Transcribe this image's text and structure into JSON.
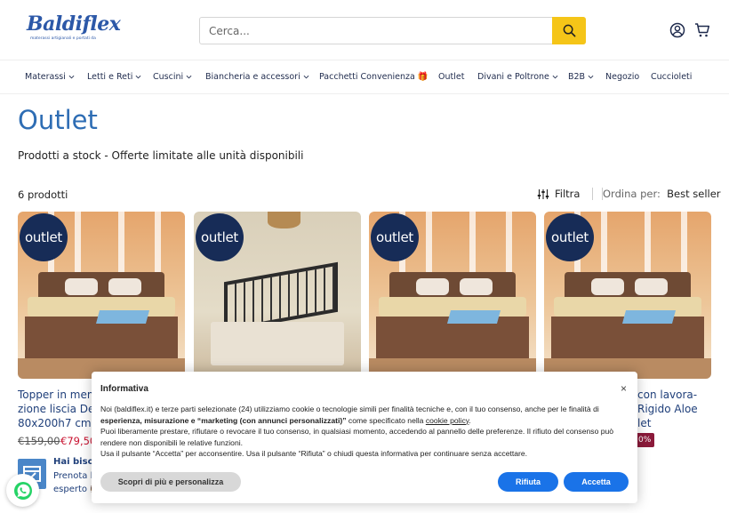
{
  "header": {
    "logo_text": "Baldiflex",
    "logo_tagline": "materassi artigianali e portati da",
    "search_placeholder": "Cerca...",
    "icons": [
      "search-icon",
      "account-icon",
      "cart-icon"
    ],
    "accent_color": "#f5c518"
  },
  "nav": {
    "items": [
      {
        "label": "Materassi",
        "dropdown": true
      },
      {
        "label": "Letti e Reti",
        "dropdown": true
      },
      {
        "label": "Cuscini",
        "dropdown": true
      },
      {
        "label": "Biancheria e accessori",
        "dropdown": true
      },
      {
        "label": "Pacchetti Convenienza 🎁",
        "dropdown": false
      },
      {
        "label": "Outlet",
        "dropdown": false
      },
      {
        "label": "Divani e Poltrone",
        "dropdown": true
      },
      {
        "label": "B2B",
        "dropdown": true
      },
      {
        "label": "Negozio",
        "dropdown": false
      },
      {
        "label": "Cuccioleti",
        "dropdown": false
      }
    ]
  },
  "page": {
    "title": "Outlet",
    "subtitle": "Prodotti a stock - Offerte limitate alle unità disponibili",
    "count": "6 prodotti",
    "filter_label": "Filtra",
    "sort_label": "Ordina per:",
    "sort_value": "Best seller",
    "title_color": "#2e6db4"
  },
  "products": [
    {
      "badge": "outlet",
      "title_lines": [
        "Topper in mem",
        "zione liscia Delu",
        "80x200h7 cm -"
      ],
      "price_old": "€159,00",
      "price_new": "€79,50"
    },
    {
      "badge": "outlet"
    },
    {
      "badge": "outlet"
    },
    {
      "badge": "outlet",
      "title_lines": [
        "con lavora-",
        "Rigido Aloe",
        "let"
      ],
      "discount": "0%"
    }
  ],
  "cookie": {
    "title": "Informativa",
    "close": "×",
    "p1a": "Noi (baldiflex.it) e terze parti selezionate (24) utilizziamo cookie o tecnologie simili per finalità tecniche e, con il tuo consenso, anche per le finalità di ",
    "p1b": "esperienza, misurazione e “marketing (con annunci personalizzati)”",
    "p1c": " come specificato nella ",
    "p1d": "cookie policy",
    "p1e": ".",
    "p2": "Puoi liberamente prestare, rifiutare o revocare il tuo consenso, in qualsiasi momento, accedendo al pannello delle preferenze. Il rifiuto del consenso può rendere non disponibili le relative funzioni.",
    "p3": "Usa il pulsante “Accetta” per acconsentire. Usa il pulsante “Rifiuta” o chiudi questa informativa per continuare senza accettare.",
    "btn_more": "Scopri di più e personalizza",
    "btn_reject": "Rifiuta",
    "btn_accept": "Accetta",
    "button_color": "#1a73e8"
  },
  "help": {
    "line1": "Hai bisogr",
    "line2": "Prenota la",
    "line3": "esperto 🧑"
  }
}
